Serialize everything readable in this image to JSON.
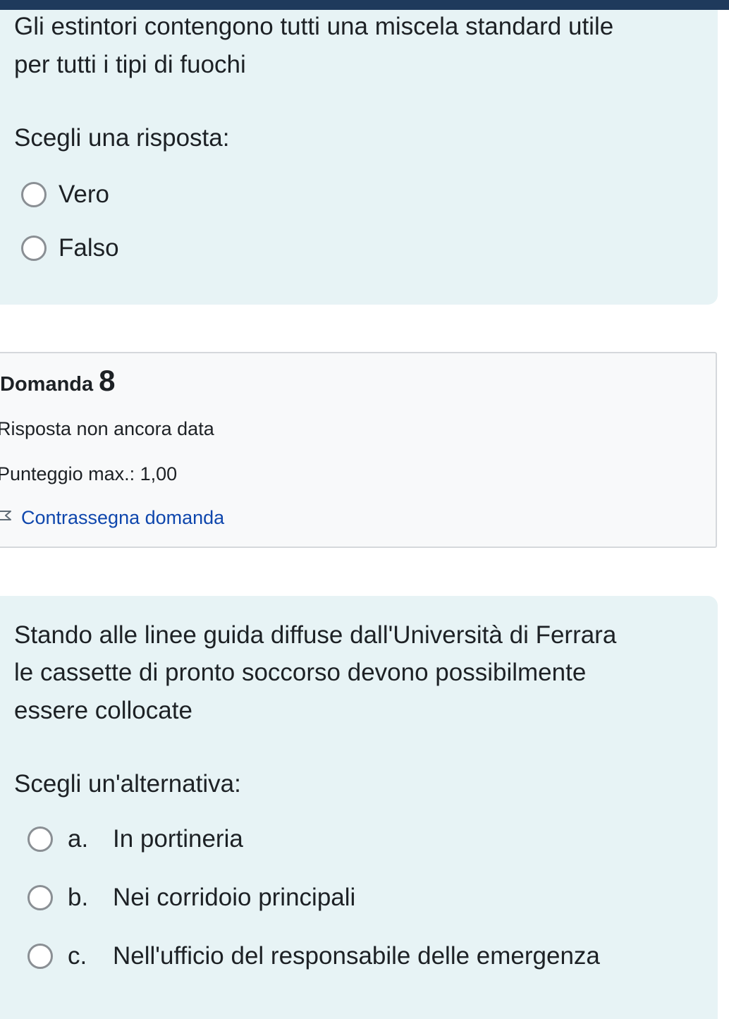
{
  "q7": {
    "text_lines": [
      "Gli estintori contengono tutti una miscela standard utile",
      "per tutti i tipi di fuochi"
    ],
    "prompt": "Scegli una risposta:",
    "options": [
      {
        "label": "Vero"
      },
      {
        "label": "Falso"
      }
    ]
  },
  "q8_info": {
    "title_word": "Domanda",
    "title_number": "8",
    "status": "Risposta non ancora data",
    "max_score": "Punteggio max.: 1,00",
    "flag_label": "Contrassegna domanda",
    "flag_icon": "flag-icon"
  },
  "q8": {
    "text_lines": [
      "Stando alle linee guida diffuse dall'Università di Ferrara",
      "le cassette di pronto soccorso devono possibilmente",
      "essere collocate"
    ],
    "prompt": "Scegli un'alternativa:",
    "options": [
      {
        "letter": "a.",
        "label": "In portineria"
      },
      {
        "letter": "b.",
        "label": "Nei corridoio principali"
      },
      {
        "letter": "c.",
        "label": "Nell'ufficio del responsabile delle emergenza"
      }
    ]
  },
  "colors": {
    "question_bg": "#e7f3f5",
    "info_bg": "#f8f9fa",
    "link": "#0f47ad",
    "top_bar": "#1f3a5c"
  }
}
